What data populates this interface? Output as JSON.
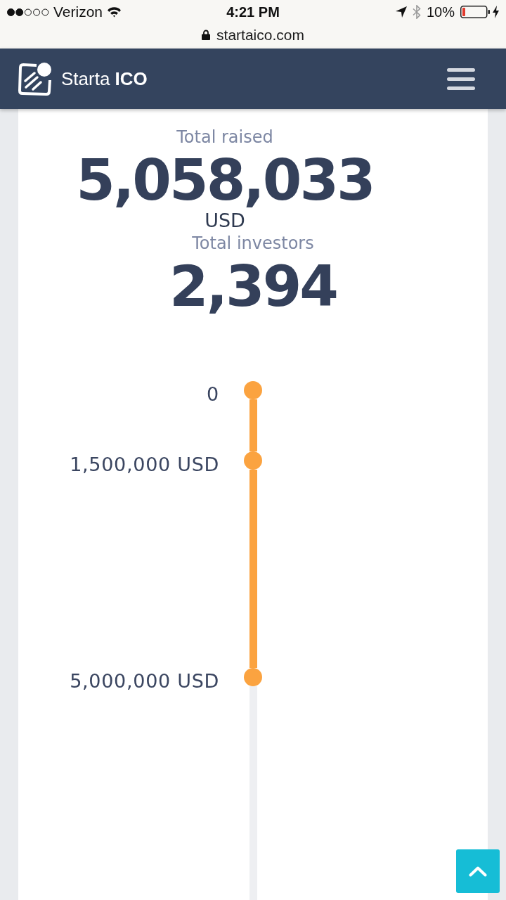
{
  "status_bar": {
    "carrier": "Verizon",
    "time": "4:21 PM",
    "battery": "10%"
  },
  "address_bar": {
    "url": "startaico.com"
  },
  "navbar": {
    "brand": "Starta **ICO**"
  },
  "stats": [
    {
      "label": "Total raised",
      "value": "5,058,033",
      "unit": "USD"
    },
    {
      "label": "Total investors",
      "value": "2,394"
    }
  ],
  "timeline": {
    "milestones": [
      {
        "label": "0",
        "reached": true
      },
      {
        "label": "1,500,000 USD",
        "reached": true
      },
      {
        "label": "5,000,000 USD",
        "reached": true
      }
    ]
  }
}
